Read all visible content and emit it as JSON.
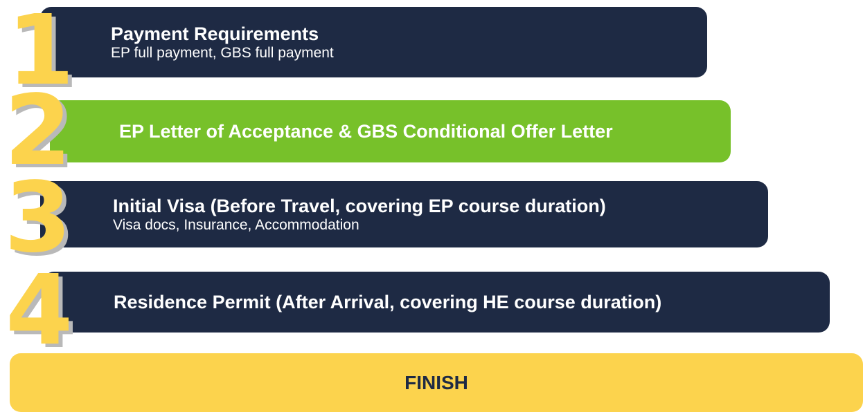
{
  "colors": {
    "navy": "#1E2A44",
    "green": "#77C12A",
    "yellow": "#FCD34D",
    "text_light": "#FFFFFF"
  },
  "steps": [
    {
      "number": "1",
      "title": "Payment Requirements",
      "subtitle": "EP full payment, GBS full payment",
      "color": "#1E2A44"
    },
    {
      "number": "2",
      "title": "EP Letter of Acceptance & GBS Conditional Offer Letter",
      "subtitle": "",
      "color": "#77C12A"
    },
    {
      "number": "3",
      "title": "Initial Visa (Before Travel, covering EP course duration)",
      "subtitle": "Visa docs, Insurance, Accommodation",
      "color": "#1E2A44"
    },
    {
      "number": "4",
      "title": "Residence Permit (After Arrival, covering HE course duration)",
      "subtitle": "",
      "color": "#1E2A44"
    }
  ],
  "finish": {
    "label": "FINISH",
    "color": "#FCD34D"
  }
}
